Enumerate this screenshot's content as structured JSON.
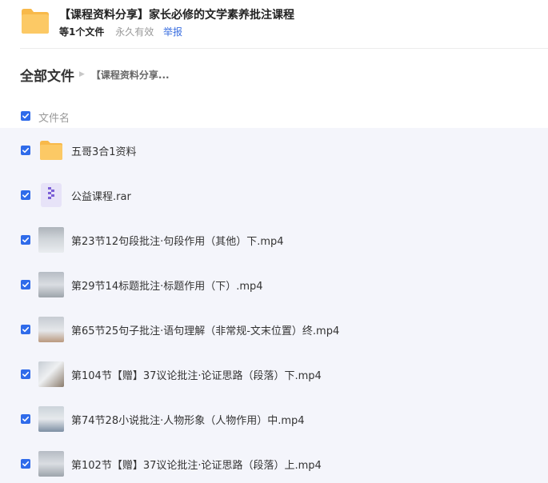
{
  "header": {
    "title": "【课程资料分享】家长必修的文学素养批注课程",
    "file_count": "等1个文件",
    "validity": "永久有效",
    "report_label": "举报"
  },
  "breadcrumb": {
    "root": "全部文件",
    "current": "【课程资料分享..."
  },
  "list_header": {
    "column_name": "文件名"
  },
  "files": [
    {
      "name": "五哥3合1资料",
      "type": "folder-icon"
    },
    {
      "name": "公益课程.rar",
      "type": "archive-icon"
    },
    {
      "name": "第23节12句段批注·句段作用（其他）下.mp4",
      "type": "video-thumbnail"
    },
    {
      "name": "第29节14标题批注·标题作用（下）.mp4",
      "type": "video-thumbnail"
    },
    {
      "name": "第65节25句子批注·语句理解（非常规-文末位置）终.mp4",
      "type": "video-thumbnail"
    },
    {
      "name": "第104节【赠】37议论批注·论证思路（段落）下.mp4",
      "type": "video-thumbnail"
    },
    {
      "name": "第74节28小说批注·人物形象（人物作用）中.mp4",
      "type": "video-thumbnail"
    },
    {
      "name": "第102节【赠】37议论批注·论证思路（段落）上.mp4",
      "type": "video-thumbnail"
    }
  ],
  "colors": {
    "accent": "#2f6bea",
    "link": "#3b6fe0",
    "folder": "#fcc965",
    "list_bg": "#f4f5fb"
  }
}
